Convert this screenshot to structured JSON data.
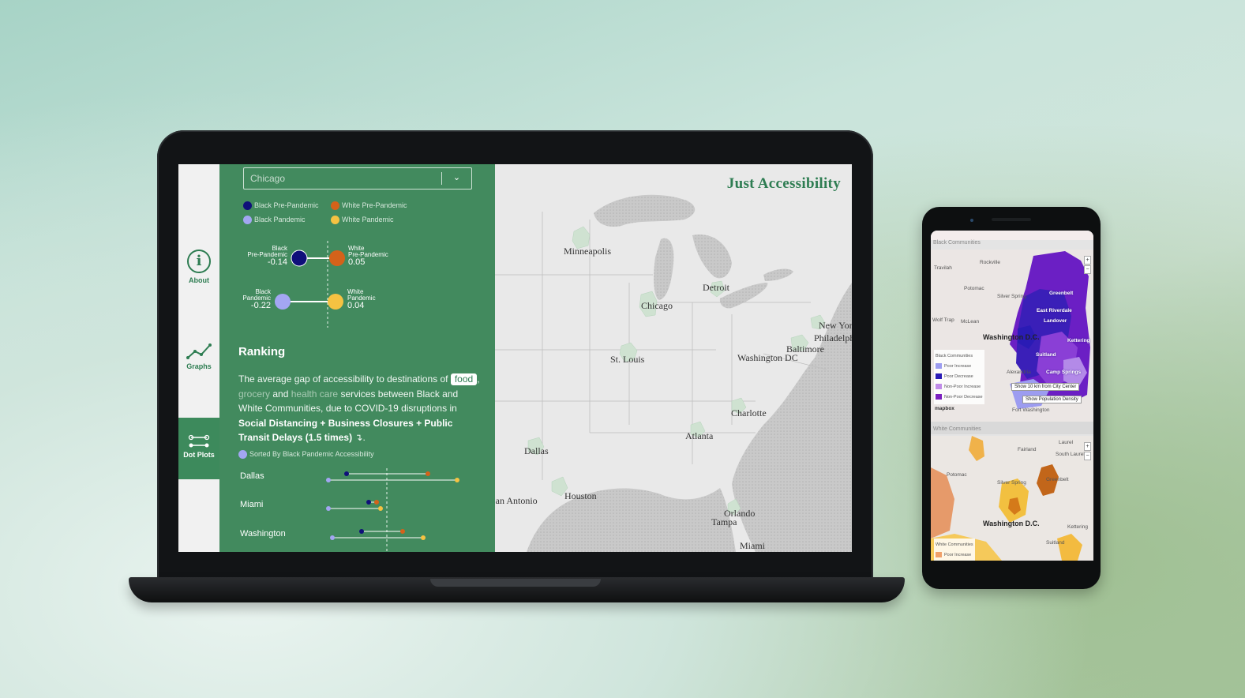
{
  "app": {
    "title": "Just Accessibility",
    "city_select": {
      "value": "Chicago",
      "chevron_icon": "chevron-down-icon"
    }
  },
  "nav": {
    "items": [
      {
        "label": "About",
        "icon": "info-icon",
        "active": false
      },
      {
        "label": "Graphs",
        "icon": "line-chart-icon",
        "active": false
      },
      {
        "label": "Dot Plots",
        "icon": "dot-plot-icon",
        "active": true
      }
    ]
  },
  "legend": {
    "items": [
      {
        "label": "Black Pre-Pandemic",
        "color": "#0f0f7a"
      },
      {
        "label": "White Pre-Pandemic",
        "color": "#d4621a"
      },
      {
        "label": "Black Pandemic",
        "color": "#a3a6f2"
      },
      {
        "label": "White Pandemic",
        "color": "#f5c242"
      }
    ]
  },
  "gap_chart": {
    "pre": {
      "black_label_1": "Black",
      "black_label_2": "Pre-Pandemic",
      "black_value": "-0.14",
      "white_label_1": "White",
      "white_label_2": "Pre-Pandemic",
      "white_value": "0.05"
    },
    "pandemic": {
      "black_label_1": "Black",
      "black_label_2": "Pandemic",
      "black_value": "-0.22",
      "white_label_1": "White",
      "white_label_2": "Pandemic",
      "white_value": "0.04"
    }
  },
  "ranking": {
    "title": "Ranking",
    "desc_1": "The average gap of accessibility to destinations of",
    "chip_food": "food",
    "sep": ",",
    "chip_grocery": "grocery",
    "and": "and",
    "chip_health": "health care",
    "desc_2": "services between Black and White Communities, due to COVID-19 disruptions in",
    "desc_strong": "Social Distancing + Business Closures + Public Transit Delays (1.5 times)",
    "desc_end": "↴.",
    "sorted_by": "Sorted By Black Pandemic Accessibility",
    "cities": [
      "Dallas",
      "Miami",
      "Washington"
    ]
  },
  "map": {
    "labels": [
      "Minneapolis",
      "Detroit",
      "Chicago",
      "New York",
      "Philadelphia",
      "Baltimore",
      "St. Louis",
      "Washington DC",
      "Charlotte",
      "Atlanta",
      "Dallas",
      "Houston",
      "San Antonio",
      "Orlando",
      "Tampa",
      "Miami"
    ]
  },
  "phone": {
    "black_section": "Black Communities",
    "white_section": "White Communities",
    "place_labels": [
      "Rockville",
      "Travilah",
      "Potomac",
      "Silver Spring",
      "Greenbelt",
      "East Riverdale",
      "Landover",
      "Washington D.C.",
      "Kettering",
      "Suitland",
      "Camp Springs",
      "Alexandria",
      "Fort Washington",
      "Wolf Trap",
      "McLean",
      "Fairland",
      "South Laurel",
      "Laurel"
    ],
    "legend_title": "Black Communities",
    "legend_items": [
      {
        "label": "Poor Increase",
        "color": "#9c9cf0"
      },
      {
        "label": "Poor Decrease",
        "color": "#2a1bb5"
      },
      {
        "label": "Non-Poor Increase",
        "color": "#c08be8"
      },
      {
        "label": "Non-Poor Decrease",
        "color": "#7b1fbf"
      }
    ],
    "btn_10km": "Show 10 km from City Center",
    "btn_density": "Show Population Density",
    "mapbox": "mapbox",
    "white_legend_title": "White Communities",
    "white_legend_item": "Poor Increase",
    "zoom_plus": "+",
    "zoom_minus": "−"
  }
}
